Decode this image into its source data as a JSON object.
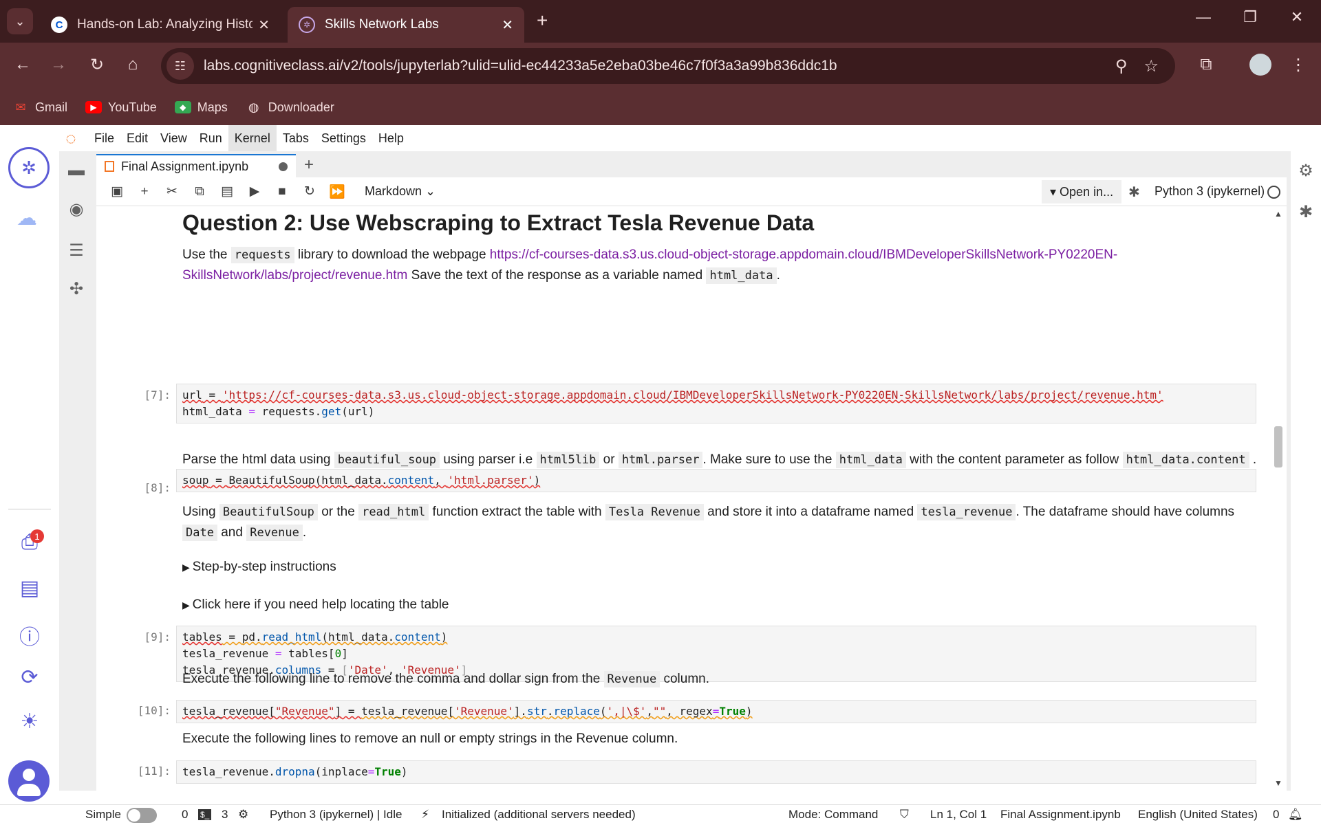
{
  "browser": {
    "tabs": [
      {
        "label": "Hands-on Lab: Analyzing Histor",
        "favicon": "C",
        "active": false
      },
      {
        "label": "Skills Network Labs",
        "favicon": "sn",
        "active": true
      }
    ],
    "url": "labs.cognitiveclass.ai/v2/tools/jupyterlab?ulid=ulid-ec44233a5e2eba03be46c7f0f3a3a99b836ddc1b",
    "bookmarks": [
      "Gmail",
      "YouTube",
      "Maps",
      "Downloader"
    ]
  },
  "jupyter": {
    "menu": [
      "File",
      "Edit",
      "View",
      "Run",
      "Kernel",
      "Tabs",
      "Settings",
      "Help"
    ],
    "active_menu": "Kernel",
    "doc_tab": "Final Assignment.ipynb",
    "cell_type": "Markdown",
    "open_in": "Open in...",
    "kernel": "Python 3 (ipykernel)",
    "notification_count": "1"
  },
  "notebook": {
    "heading": "Question 2: Use Webscraping to Extract Tesla Revenue Data",
    "md1": {
      "t1": "Use the ",
      "c1": "requests",
      "t2": " library to download the webpage ",
      "link": "https://cf-courses-data.s3.us.cloud-object-storage.appdomain.cloud/IBMDeveloperSkillsNetwork-PY0220EN-SkillsNetwork/labs/project/revenue.htm",
      "t3": " Save the text of the response as a variable named ",
      "c2": "html_data",
      "t4": "."
    },
    "cell7": {
      "prompt": "[7]:",
      "l1_a": "url",
      "l1_b": " = ",
      "l1_c": "'https://cf-courses-data.s3.us.cloud-object-storage.appdomain.cloud/IBMDeveloperSkillsNetwork-PY0220EN-SkillsNetwork/labs/project/revenue.htm'",
      "l2_a": "html_data ",
      "l2_b": "=",
      "l2_c": " requests.",
      "l2_d": "get",
      "l2_e": "(url)"
    },
    "md2": {
      "t1": "Parse the html data using ",
      "c1": "beautiful_soup",
      "t2": " using parser i.e ",
      "c2": "html5lib",
      "t3": " or ",
      "c3": "html.parser",
      "t4": ". Make sure to use the ",
      "c4": "html_data",
      "t5": " with the content parameter as follow ",
      "c5": "html_data.content",
      "t6": " ."
    },
    "cell8": {
      "prompt": "[8]:",
      "a": "soup",
      "b": " = ",
      "c": "BeautifulSoup(html_data.",
      "d": "content",
      "e": ", ",
      "f": "'html.parser'",
      "g": ")"
    },
    "md3": {
      "t1": "Using ",
      "c1": "BeautifulSoup",
      "t2": " or the ",
      "c2": "read_html",
      "t3": " function extract the table with ",
      "c3": "Tesla Revenue",
      "t4": " and store it into a dataframe named ",
      "c4": "tesla_revenue",
      "t5": ". The dataframe should have columns ",
      "c5": "Date",
      "t6": " and ",
      "c6": "Revenue",
      "t7": "."
    },
    "details1": "Step-by-step instructions",
    "details2": "Click here if you need help locating the table",
    "cell9": {
      "prompt": "[9]:",
      "l1_a": "tables",
      "l1_b": " = ",
      "l1_c": "pd.",
      "l1_d": "read_html",
      "l1_e": "(html_data.",
      "l1_f": "content",
      "l1_g": ")",
      "l2_a": "tesla_revenue ",
      "l2_b": "=",
      "l2_c": " tables[",
      "l2_d": "0",
      "l2_e": "]",
      "l3_a": "tesla_revenue.",
      "l3_b": "columns",
      "l3_c": " = ",
      "l3_d": "[",
      "l3_e": "'Date'",
      "l3_f": ", ",
      "l3_g": "'Revenue'",
      "l3_h": "]"
    },
    "md4": {
      "t1": "Execute the following line to remove the comma and dollar sign from the ",
      "c1": "Revenue",
      "t2": " column."
    },
    "cell10": {
      "prompt": "[10]:",
      "a": "tesla_revenue[",
      "b": "\"Revenue\"",
      "c": "]",
      "d": " = ",
      "e": "tesla_revenue[",
      "f": "'Revenue'",
      "g": "].",
      "h": "str",
      "i": ".",
      "j": "replace",
      "k": "(",
      "l": "',|\\$'",
      "m": ",",
      "n": "\"\"",
      "o": ", regex",
      "p": "=",
      "q": "True",
      "r": ")"
    },
    "md5": "Execute the following lines to remove an null or empty strings in the Revenue column.",
    "cell11": {
      "prompt": "[11]:",
      "a": "tesla_revenue.",
      "b": "dropna",
      "c": "(inplace",
      "d": "=",
      "e": "True",
      "f": ")"
    }
  },
  "statusbar": {
    "mode_toggle": "Simple",
    "count1": "0",
    "count2": "3",
    "kernel_status": "Python 3 (ipykernel) | Idle",
    "servers": "Initialized (additional servers needed)",
    "mode": "Mode: Command",
    "position": "Ln 1, Col 1",
    "file": "Final Assignment.ipynb",
    "language": "English (United States)",
    "notif_count": "0"
  }
}
